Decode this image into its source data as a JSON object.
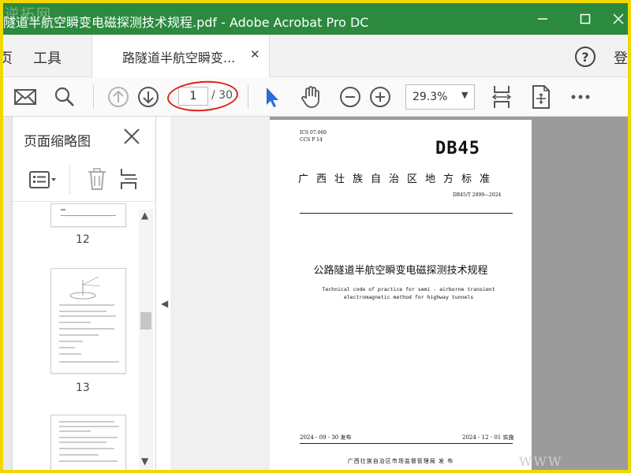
{
  "window": {
    "title": "隧道半航空瞬变电磁探测技术规程.pdf - Adobe Acrobat Pro DC",
    "watermark": "逆拓网"
  },
  "tabs": {
    "home": "页",
    "tools": "工具",
    "document": "路隧道半航空瞬变...",
    "signin": "登"
  },
  "toolbar": {
    "current_page": "1",
    "total_pages": "/ 30",
    "zoom": "29.3%"
  },
  "thumbnails_panel": {
    "title": "页面缩略图",
    "pages": [
      {
        "label": "12"
      },
      {
        "label": "13"
      },
      {
        "label": ""
      }
    ]
  },
  "pdf": {
    "ics_line1": "ICS 07.060",
    "ics_line2": "CCS P 14",
    "code": "DB45",
    "standard_type": "广西壮族自治区地方标准",
    "standard_number": "DB45/T 2899—2024",
    "title_cn": "公路隧道半航空瞬变电磁探测技术规程",
    "title_en": "Technical code of practice for semi - airborne transient electromagnetic method for highway tunnels",
    "publish_date": "2024 - 09 - 30 发布",
    "implement_date": "2024 - 12 - 01 实施",
    "issuer": "广西壮族自治区市场监督管理局    发 布"
  },
  "footer_watermark": "WWW",
  "colors": {
    "titlebar": "#2b8a3e",
    "frame": "#f0d800",
    "select_arrow": "#2b6cd6",
    "annotation": "#e0201c"
  }
}
